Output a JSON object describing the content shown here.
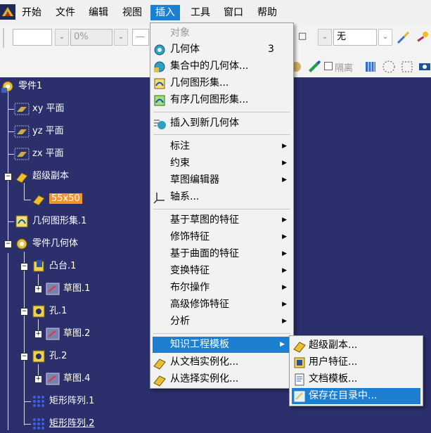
{
  "menubar": {
    "items": [
      "开始",
      "文件",
      "编辑",
      "视图",
      "插入",
      "工具",
      "窗口",
      "帮助"
    ],
    "active_index": 4
  },
  "toolbar": {
    "line_field": "",
    "percent_field": "0%",
    "dash_field": "—",
    "none_field": "无",
    "isolate_label": "隔离"
  },
  "tree": {
    "root": "零件1",
    "planes": [
      "xy 平面",
      "yz 平面",
      "zx 平面"
    ],
    "super_copy": "超级副本",
    "selected_item": "55x50",
    "geom_set": "几何图形集.1",
    "part_body": "零件几何体",
    "pad": "凸台.1",
    "sketch1": "草图.1",
    "hole1": "孔.1",
    "sketch2": "草图.2",
    "hole2": "孔.2",
    "sketch4": "草图.4",
    "pattern1": "矩形阵列.1",
    "pattern2": "矩形阵列.2"
  },
  "insert_menu": {
    "object": "对象",
    "body": "几何体",
    "body_shortcut": "3",
    "body_in_set": "集合中的几何体...",
    "geometric_set": "几何图形集...",
    "ordered_geometric_set": "有序几何图形集...",
    "insert_in_new_body": "插入到新几何体",
    "annotations": "标注",
    "constraints": "约束",
    "sketcher": "草图编辑器",
    "axis_system": "轴系...",
    "sketch_based_features": "基于草图的特征",
    "dress_up_features": "修饰特征",
    "surface_based_features": "基于曲面的特征",
    "transformation_features": "变换特征",
    "boolean_operations": "布尔操作",
    "advanced_dress_up": "高级修饰特征",
    "analysis": "分析",
    "knowledge_templates": "知识工程模板",
    "instantiate_from_document": "从文档实例化...",
    "instantiate_from_selection": "从选择实例化..."
  },
  "knowledge_submenu": {
    "power_copy": "超级副本...",
    "user_feature": "用户特征...",
    "document_template": "文档模板...",
    "save_in_catalog": "保存在目录中..."
  },
  "colors": {
    "menu_highlight": "#1c7fd1",
    "tree_background": "#2b2f6b",
    "selection": "#f3962a"
  }
}
